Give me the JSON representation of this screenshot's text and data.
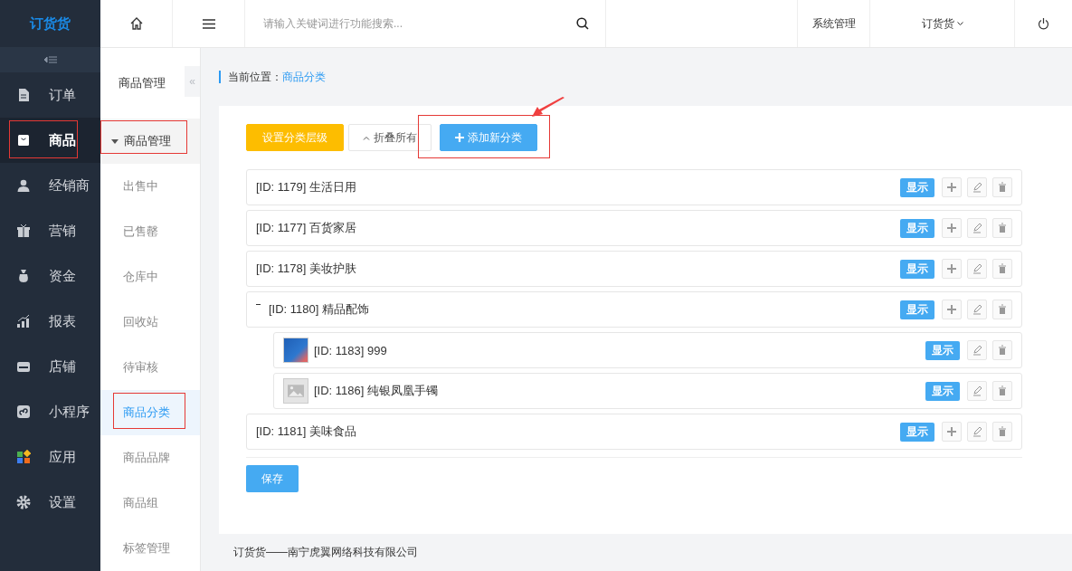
{
  "logo": "订货货",
  "nav": [
    {
      "label": "订单",
      "selected": false,
      "annotated": false
    },
    {
      "label": "商品",
      "selected": true,
      "annotated": true
    },
    {
      "label": "经销商",
      "selected": false,
      "annotated": false
    },
    {
      "label": "营销",
      "selected": false,
      "annotated": false
    },
    {
      "label": "资金",
      "selected": false,
      "annotated": false
    },
    {
      "label": "报表",
      "selected": false,
      "annotated": false
    },
    {
      "label": "店铺",
      "selected": false,
      "annotated": false
    },
    {
      "label": "小程序",
      "selected": false,
      "annotated": false
    },
    {
      "label": "应用",
      "selected": false,
      "annotated": false
    },
    {
      "label": "设置",
      "selected": false,
      "annotated": false
    }
  ],
  "subnav": {
    "title": "商品管理",
    "collapse_glyph": "«",
    "group": {
      "label": "商品管理",
      "expanded": true,
      "annotated": true
    },
    "items": [
      {
        "label": "出售中",
        "selected": false,
        "annotated": false
      },
      {
        "label": "已售罄",
        "selected": false,
        "annotated": false
      },
      {
        "label": "仓库中",
        "selected": false,
        "annotated": false
      },
      {
        "label": "回收站",
        "selected": false,
        "annotated": false
      },
      {
        "label": "待审核",
        "selected": false,
        "annotated": false
      },
      {
        "label": "商品分类",
        "selected": true,
        "annotated": true
      },
      {
        "label": "商品品牌",
        "selected": false,
        "annotated": false
      },
      {
        "label": "商品组",
        "selected": false,
        "annotated": false
      },
      {
        "label": "标签管理",
        "selected": false,
        "annotated": false
      }
    ]
  },
  "topbar": {
    "search": {
      "placeholder": "请输入关键词进行功能搜索..."
    },
    "links": [
      "系统管理",
      "订货货"
    ]
  },
  "breadcrumb": {
    "label": "当前位置：",
    "current": "商品分类"
  },
  "toolbar": [
    {
      "label": "设置分类层级",
      "kind": "warning",
      "annotated": false
    },
    {
      "label": "折叠所有",
      "kind": "default",
      "annotated": false
    },
    {
      "label": "添加新分类",
      "kind": "primary",
      "annotated": true
    }
  ],
  "categories": [
    {
      "label": "[ID: 1179] 生活日用",
      "status": "显示"
    },
    {
      "label": "[ID: 1177] 百货家居",
      "status": "显示"
    },
    {
      "label": "[ID: 1178] 美妆护肤",
      "status": "显示"
    },
    {
      "label": "[ID: 1180] 精品配饰",
      "status": "显示",
      "expanded": true,
      "children": [
        {
          "label": "[ID: 1183] 999",
          "status": "显示",
          "kind": "photo"
        },
        {
          "label": "[ID: 1186] 纯银凤凰手镯",
          "status": "显示",
          "kind": "placeholder"
        }
      ]
    },
    {
      "label": "[ID: 1181] 美味食品",
      "status": "显示"
    }
  ],
  "save": "保存",
  "footer": "订货货——南宁虎翼网络科技有限公司"
}
